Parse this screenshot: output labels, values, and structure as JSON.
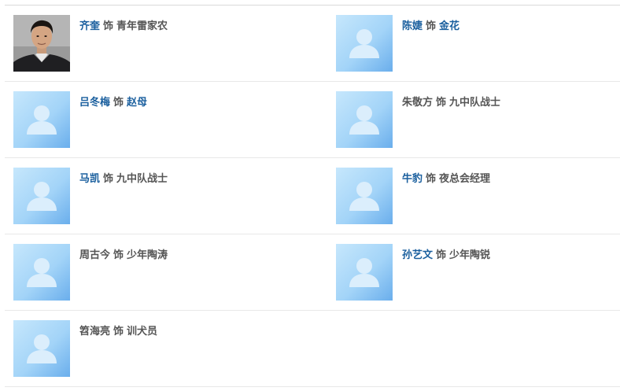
{
  "cast_list": {
    "separator": "饰",
    "rows": [
      [
        {
          "actor": "齐奎",
          "role": "青年雷家农",
          "actor_link": true,
          "role_link": false,
          "photo": "actor-portrait"
        },
        {
          "actor": "陈婕",
          "role": "金花",
          "actor_link": true,
          "role_link": true,
          "photo": "default-avatar"
        }
      ],
      [
        {
          "actor": "吕冬梅",
          "role": "赵母",
          "actor_link": true,
          "role_link": true,
          "photo": "default-avatar"
        },
        {
          "actor": "朱敬方",
          "role": "九中队战士",
          "actor_link": false,
          "role_link": false,
          "photo": "default-avatar"
        }
      ],
      [
        {
          "actor": "马凯",
          "role": "九中队战士",
          "actor_link": true,
          "role_link": false,
          "photo": "default-avatar"
        },
        {
          "actor": "牛豹",
          "role": "夜总会经理",
          "actor_link": true,
          "role_link": false,
          "photo": "default-avatar"
        }
      ],
      [
        {
          "actor": "周古今",
          "role": "少年陶涛",
          "actor_link": false,
          "role_link": false,
          "photo": "default-avatar"
        },
        {
          "actor": "孙艺文",
          "role": "少年陶锐",
          "actor_link": true,
          "role_link": false,
          "photo": "default-avatar"
        }
      ],
      [
        {
          "actor": "笤海亮",
          "role": "训犬员",
          "actor_link": false,
          "role_link": false,
          "photo": "default-avatar"
        }
      ]
    ]
  },
  "colors": {
    "link": "#1a5f9e",
    "text": "#555555",
    "divider": "#e8e8e8",
    "avatar_bg_light": "#b9e0fb",
    "avatar_bg_dark": "#6fb4ee",
    "avatar_figure": "#dbeefc"
  }
}
